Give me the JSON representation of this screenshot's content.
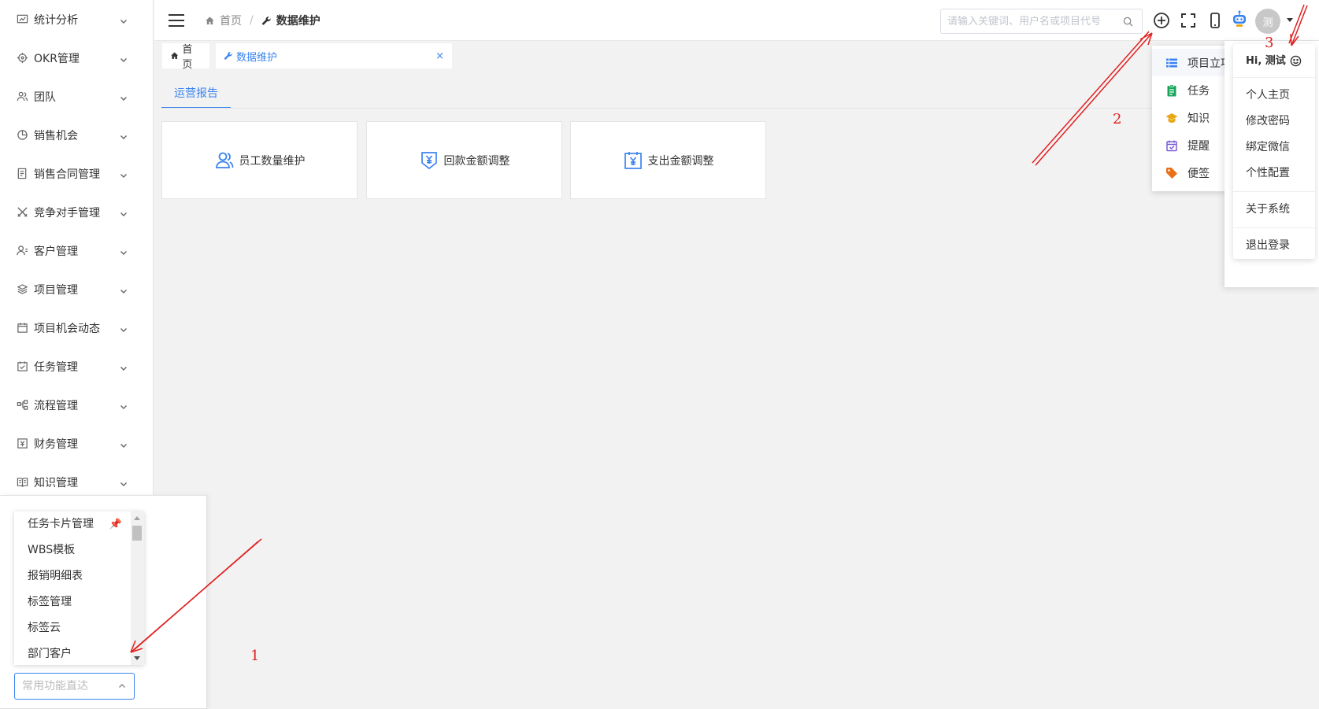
{
  "sidebar": {
    "items": [
      {
        "label": "统计分析",
        "icon": "chart-icon"
      },
      {
        "label": "OKR管理",
        "icon": "target-icon"
      },
      {
        "label": "团队",
        "icon": "team-icon"
      },
      {
        "label": "销售机会",
        "icon": "pie-icon"
      },
      {
        "label": "销售合同管理",
        "icon": "contract-icon"
      },
      {
        "label": "竞争对手管理",
        "icon": "swords-icon"
      },
      {
        "label": "客户管理",
        "icon": "customer-icon"
      },
      {
        "label": "项目管理",
        "icon": "layers-icon"
      },
      {
        "label": "项目机会动态",
        "icon": "calendar-icon"
      },
      {
        "label": "任务管理",
        "icon": "task-icon"
      },
      {
        "label": "流程管理",
        "icon": "flow-icon"
      },
      {
        "label": "财务管理",
        "icon": "finance-icon"
      },
      {
        "label": "知识管理",
        "icon": "book-icon"
      }
    ]
  },
  "quick_access": {
    "items": [
      "任务卡片管理",
      "WBS模板",
      "报销明细表",
      "标签管理",
      "标签云",
      "部门客户"
    ],
    "pinned_icon": "pin-icon",
    "placeholder": "常用功能直达"
  },
  "header": {
    "breadcrumb_home": "首页",
    "breadcrumb_sep": "/",
    "breadcrumb_current": "数据维护",
    "search_placeholder": "请输入关键词、用户名或项目代号",
    "avatar_text": "测"
  },
  "tabs": {
    "home": "首页",
    "active": "数据维护",
    "close": "×"
  },
  "content": {
    "tab": "运营报告",
    "cards": [
      {
        "label": "员工数量维护",
        "icon": "users-icon"
      },
      {
        "label": "回款金额调整",
        "icon": "yuan-shield-icon"
      },
      {
        "label": "支出金额调整",
        "icon": "yuan-calendar-icon"
      }
    ]
  },
  "create_menu": {
    "items": [
      {
        "label": "项目立项",
        "icon": "list-icon",
        "color": "#3a84f0"
      },
      {
        "label": "任务",
        "icon": "clipboard-icon",
        "color": "#19a55a"
      },
      {
        "label": "知识",
        "icon": "graduation-icon",
        "color": "#e6a817"
      },
      {
        "label": "提醒",
        "icon": "calendar-check-icon",
        "color": "#7b5cd6"
      },
      {
        "label": "便签",
        "icon": "tag-icon",
        "color": "#e8701a"
      }
    ]
  },
  "user_menu": {
    "greeting": "Hi, 测试",
    "group1": [
      "个人主页",
      "修改密码",
      "绑定微信",
      "个性配置"
    ],
    "group2": [
      "关于系统"
    ],
    "group3": [
      "退出登录"
    ]
  },
  "annotations": {
    "one": "1",
    "two": "2",
    "three": "3",
    "color": "#e02020"
  },
  "colors": {
    "accent": "#3a84f0"
  }
}
